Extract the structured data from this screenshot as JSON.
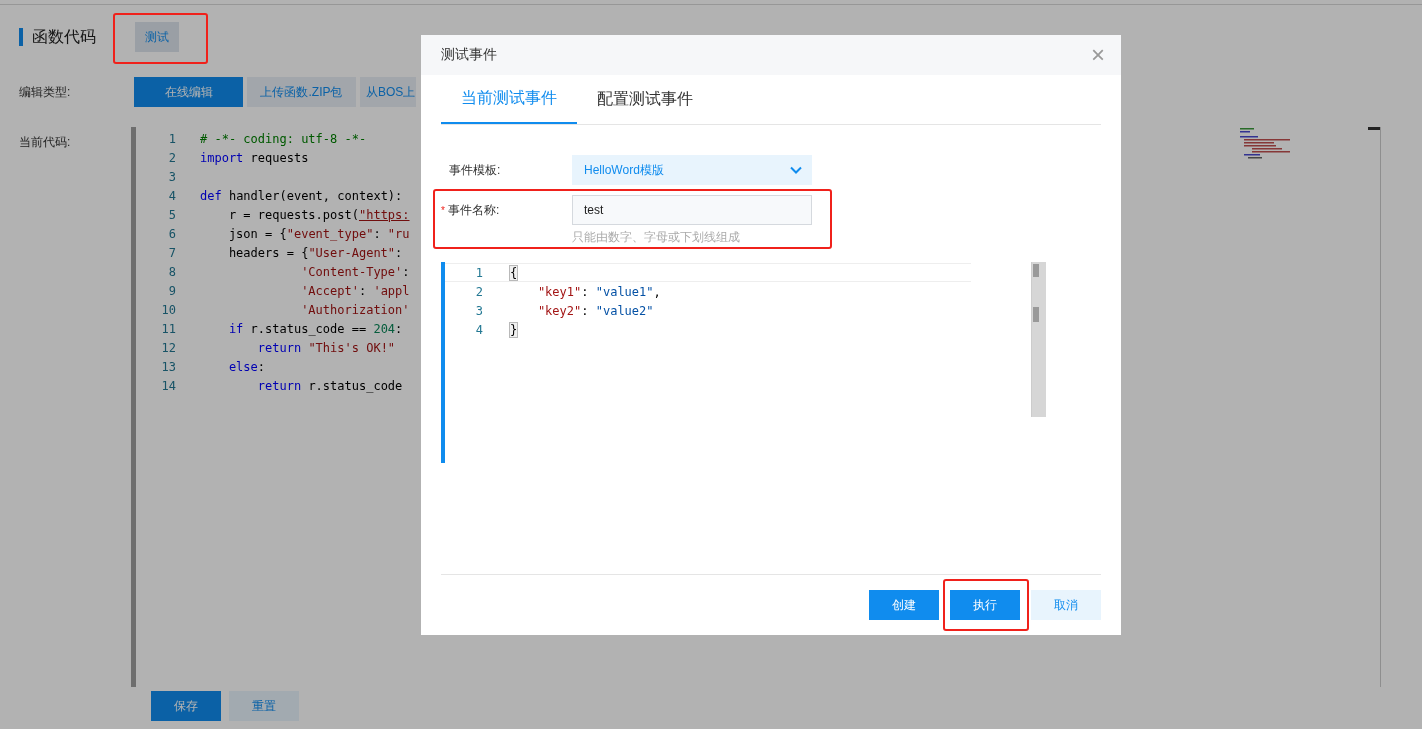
{
  "page": {
    "title": "函数代码",
    "test_button": {
      "label": "测试",
      "highlighted": true
    },
    "edit_type": {
      "label": "编辑类型:",
      "options": [
        {
          "label": "在线编辑",
          "selected": true
        },
        {
          "label": "上传函数.ZIP包",
          "selected": false
        },
        {
          "label": "从BOS上",
          "selected": false
        }
      ]
    },
    "code": {
      "label": "当前代码:",
      "lines": [
        {
          "number": "1",
          "tokens": [
            {
              "kind": "comment",
              "text": "# -*- coding: utf-8 -*-"
            }
          ]
        },
        {
          "number": "2",
          "tokens": [
            {
              "kind": "keyword",
              "text": "import"
            },
            {
              "kind": "plain",
              "text": " requests"
            }
          ]
        },
        {
          "number": "3"
        },
        {
          "number": "4",
          "tokens": [
            {
              "kind": "keyword",
              "text": "def"
            },
            {
              "kind": "plain",
              "text": " handler(event, context):"
            }
          ]
        },
        {
          "number": "5",
          "tokens": [
            {
              "kind": "plain",
              "text": "    r = requests.post("
            },
            {
              "kind": "url",
              "text": "\"https:"
            }
          ]
        },
        {
          "number": "6",
          "tokens": [
            {
              "kind": "plain",
              "text": "    json = {"
            },
            {
              "kind": "string",
              "text": "\"event_type\""
            },
            {
              "kind": "plain",
              "text": ": "
            },
            {
              "kind": "string",
              "text": "\"ru"
            }
          ]
        },
        {
          "number": "7",
          "tokens": [
            {
              "kind": "plain",
              "text": "    headers = {"
            },
            {
              "kind": "string",
              "text": "\"User-Agent\""
            },
            {
              "kind": "plain",
              "text": ":"
            }
          ]
        },
        {
          "number": "8",
          "tokens": [
            {
              "kind": "string",
              "text": "              'Content-Type'"
            },
            {
              "kind": "plain",
              "text": ":"
            }
          ]
        },
        {
          "number": "9",
          "tokens": [
            {
              "kind": "string",
              "text": "              'Accept'"
            },
            {
              "kind": "plain",
              "text": ": "
            },
            {
              "kind": "string",
              "text": "'appl"
            }
          ]
        },
        {
          "number": "10",
          "tokens": [
            {
              "kind": "string",
              "text": "              'Authorization'"
            }
          ]
        },
        {
          "number": "11",
          "tokens": [
            {
              "kind": "keyword",
              "text": "    if"
            },
            {
              "kind": "plain",
              "text": " r.status_code == "
            },
            {
              "kind": "number",
              "text": "204"
            },
            {
              "kind": "plain",
              "text": ":"
            }
          ]
        },
        {
          "number": "12",
          "tokens": [
            {
              "kind": "keyword",
              "text": "        return"
            },
            {
              "kind": "string",
              "text": " \"This's OK!\""
            }
          ]
        },
        {
          "number": "13",
          "tokens": [
            {
              "kind": "keyword",
              "text": "    else"
            },
            {
              "kind": "plain",
              "text": ":"
            }
          ]
        },
        {
          "number": "14",
          "tokens": [
            {
              "kind": "keyword",
              "text": "        return"
            },
            {
              "kind": "plain",
              "text": " r.status_code"
            }
          ]
        }
      ]
    },
    "buttons": [
      {
        "label": "保存",
        "kind": "primary"
      },
      {
        "label": "重置",
        "kind": "secondary"
      }
    ]
  },
  "dialog": {
    "title": "测试事件",
    "close": "×",
    "tabs": [
      {
        "label": "当前测试事件",
        "selected": true
      },
      {
        "label": "配置测试事件",
        "selected": false
      }
    ],
    "template": {
      "label": "事件模板:",
      "value": "HelloWord模版"
    },
    "event_name": {
      "label": "事件名称:",
      "required_mark": "*",
      "value": "test",
      "hint": "只能由数字、字母或下划线组成",
      "highlighted": true
    },
    "editor_lines": [
      {
        "number": "1",
        "tokens": [
          {
            "kind": "bracket",
            "text": "{"
          }
        ]
      },
      {
        "number": "2",
        "tokens": [
          {
            "kind": "key",
            "text": "    \"key1\""
          },
          {
            "kind": "plain",
            "text": ": "
          },
          {
            "kind": "value",
            "text": "\"value1\""
          },
          {
            "kind": "plain",
            "text": ","
          }
        ]
      },
      {
        "number": "3",
        "tokens": [
          {
            "kind": "key",
            "text": "    \"key2\""
          },
          {
            "kind": "plain",
            "text": ": "
          },
          {
            "kind": "value",
            "text": "\"value2\""
          }
        ]
      },
      {
        "number": "4",
        "tokens": [
          {
            "kind": "bracket",
            "text": "}"
          }
        ]
      }
    ],
    "buttons": [
      {
        "label": "创建",
        "kind": "primary",
        "highlighted": false
      },
      {
        "label": "执行",
        "kind": "primary",
        "highlighted": true
      },
      {
        "label": "取消",
        "kind": "secondary",
        "highlighted": false
      }
    ]
  }
}
